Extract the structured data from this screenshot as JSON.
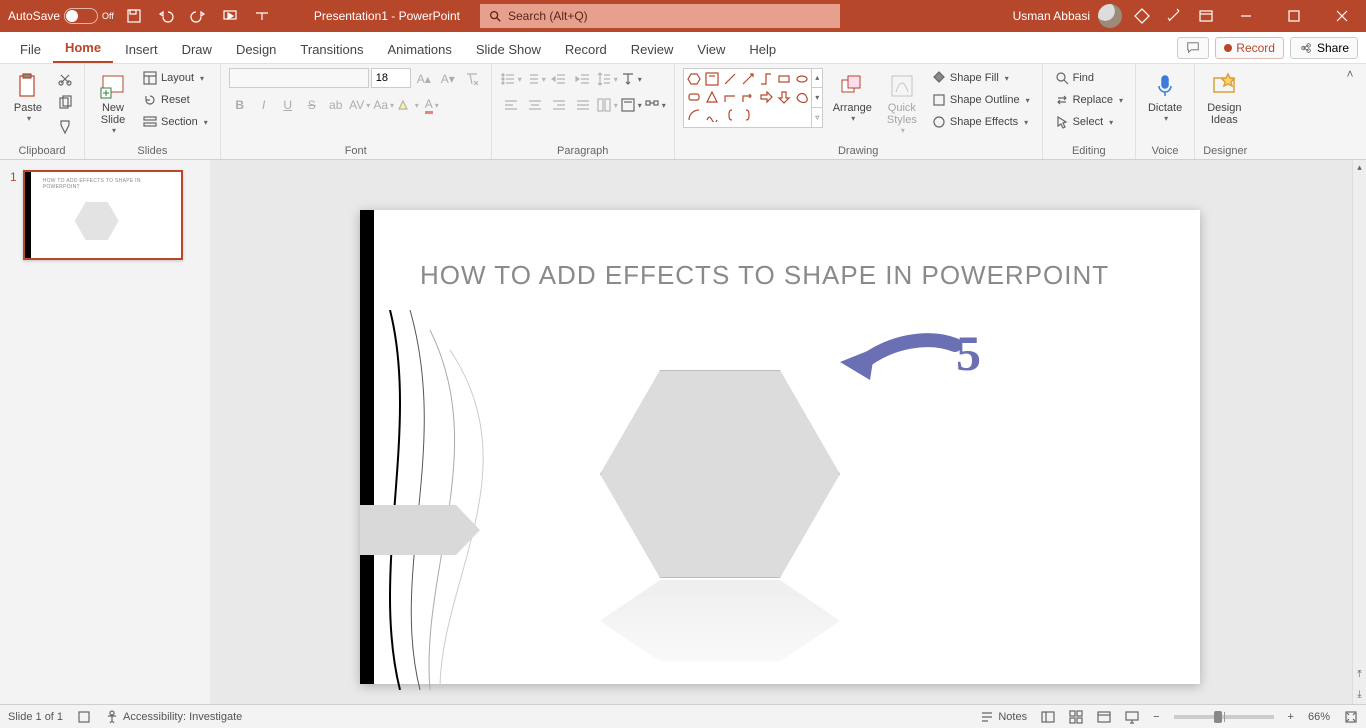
{
  "titlebar": {
    "autosave_label": "AutoSave",
    "autosave_state": "Off",
    "doc_title": "Presentation1 - PowerPoint",
    "search_placeholder": "Search (Alt+Q)",
    "user_name": "Usman Abbasi"
  },
  "tabs": {
    "items": [
      "File",
      "Home",
      "Insert",
      "Draw",
      "Design",
      "Transitions",
      "Animations",
      "Slide Show",
      "Record",
      "Review",
      "View",
      "Help"
    ],
    "active": "Home",
    "record_label": "Record",
    "share_label": "Share"
  },
  "ribbon": {
    "clipboard": {
      "label": "Clipboard",
      "paste": "Paste"
    },
    "slides": {
      "label": "Slides",
      "new_slide": "New\nSlide",
      "layout": "Layout",
      "reset": "Reset",
      "section": "Section"
    },
    "font": {
      "label": "Font",
      "size": "18"
    },
    "paragraph": {
      "label": "Paragraph"
    },
    "drawing": {
      "label": "Drawing",
      "arrange": "Arrange",
      "quick_styles": "Quick\nStyles",
      "shape_fill": "Shape Fill",
      "shape_outline": "Shape Outline",
      "shape_effects": "Shape Effects"
    },
    "editing": {
      "label": "Editing",
      "find": "Find",
      "replace": "Replace",
      "select": "Select"
    },
    "voice": {
      "label": "Voice",
      "dictate": "Dictate"
    },
    "designer": {
      "label": "Designer",
      "design_ideas": "Design\nIdeas"
    }
  },
  "thumbs": {
    "num": "1",
    "title": "HOW TO ADD EFFECTS TO SHAPE IN POWERPOINT"
  },
  "slide": {
    "title": "HOW TO ADD EFFECTS TO SHAPE IN POWERPOINT",
    "annotation_number": "5"
  },
  "status": {
    "slide_counter": "Slide 1 of 1",
    "accessibility": "Accessibility: Investigate",
    "notes": "Notes",
    "zoom": "66%"
  }
}
